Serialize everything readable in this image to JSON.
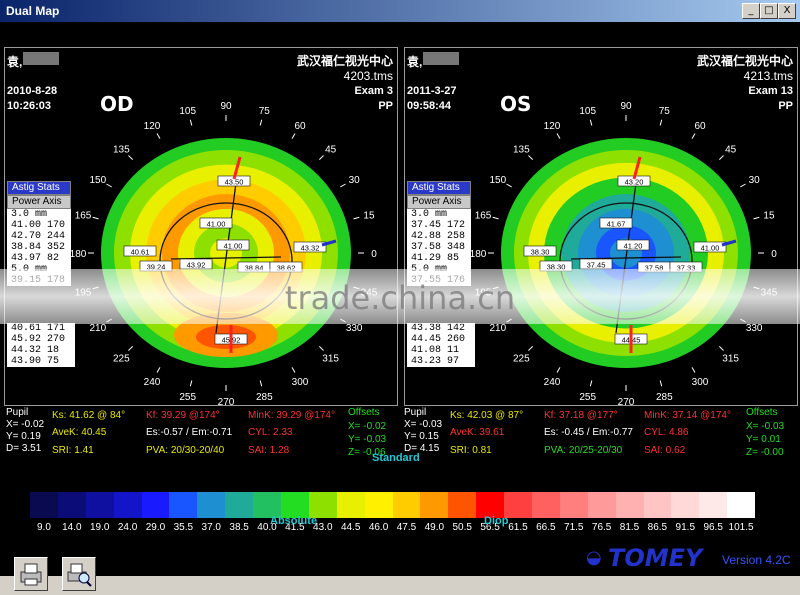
{
  "window": {
    "title": "Dual Map",
    "min": "_",
    "max": "□",
    "close": "X"
  },
  "left": {
    "patient": "袁,",
    "clinic": "武汉福仁视光中心",
    "file": "4203.tms",
    "exam": "Exam 3",
    "date": "2010-8-28",
    "time": "10:26:03",
    "pp": "PP",
    "eye": "OD",
    "astig": {
      "btn1": "Astig Stats",
      "btn2": "Power Axis",
      "rows": [
        "3.0 mm",
        "41.00 170",
        "42.70 244",
        "38.84 352",
        "43.97 82",
        "5.0 mm",
        "39.15 178"
      ],
      "rows2": [
        "40.61 171",
        "45.92 270",
        "44.32 18",
        "43.90 75"
      ]
    },
    "marks": [
      "43.50",
      "41.00",
      "40.61",
      "39.24",
      "43.92",
      "41.00",
      "38.84",
      "38.62",
      "43.32",
      "45.92"
    ],
    "stats": {
      "pupil": "Pupil",
      "x": "X= -0.02",
      "y": "Y= 0.19",
      "d": "D= 3.51",
      "ks": "Ks: 41.62 @ 84°",
      "avek": "AveK: 40.45",
      "sri": "SRI: 1.41",
      "kf": "Kf: 39.29 @174°",
      "es": "Es:-0.57 / Em:-0.71",
      "pva": "PVA: 20/30-20/40",
      "mink": "MinK: 39.29 @174°",
      "cyl": "CYL: 2.33",
      "sai": "SAI: 1.28",
      "offsets": "Offsets",
      "ox": "X= -0.02",
      "oy": "Y= -0.03",
      "oz": "Z= -0.06"
    }
  },
  "right": {
    "patient": "袁,",
    "clinic": "武汉福仁视光中心",
    "file": "4213.tms",
    "exam": "Exam 13",
    "date": "2011-3-27",
    "time": "09:58:44",
    "pp": "PP",
    "eye": "OS",
    "astig": {
      "btn1": "Astig Stats",
      "btn2": "Power Axis",
      "rows": [
        "3.0 mm",
        "37.45 172",
        "42.88 258",
        "37.58 348",
        "41.29 85",
        "5.0 mm",
        "37.55 176"
      ],
      "rows2": [
        "43.38 142",
        "44.45 260",
        "41.08 11",
        "43.23 97"
      ]
    },
    "marks": [
      "43.20",
      "41.67",
      "38.30",
      "38.30",
      "37.45",
      "41.20",
      "37.58",
      "37.33",
      "41.00",
      "44.45"
    ],
    "stats": {
      "pupil": "Pupil",
      "x": "X= -0.03",
      "y": "Y= 0.15",
      "d": "D= 4.15",
      "ks": "Ks: 42.03 @ 87°",
      "avek": "AveK: 39.61",
      "sri": "SRI: 0.81",
      "kf": "Kf: 37.18 @177°",
      "es": "Es: -0.45 / Em:-0.77",
      "pva": "PVA: 20/25-20/30",
      "mink": "MinK: 37.14 @174°",
      "cyl": "CYL: 4.86",
      "sai": "SAI: 0.62",
      "offsets": "Offsets",
      "ox": "X= -0.03",
      "oy": "Y= 0.01",
      "oz": "Z= -0.00"
    }
  },
  "axis_ticks": [
    "0",
    "15",
    "30",
    "45",
    "60",
    "75",
    "90",
    "105",
    "120",
    "135",
    "150",
    "165",
    "180",
    "195",
    "210",
    "225",
    "240",
    "255",
    "270",
    "285",
    "300",
    "315",
    "330",
    "345"
  ],
  "watermark": "trade.china.cn",
  "scale": {
    "name": "Standard",
    "mode_left": "Absolute",
    "mode_right": "Diop",
    "labels": [
      "9.0",
      "14.0",
      "19.0",
      "24.0",
      "29.0",
      "35.5",
      "37.0",
      "38.5",
      "40.0",
      "41.5",
      "43.0",
      "44.5",
      "46.0",
      "47.5",
      "49.0",
      "50.5",
      "56.5",
      "61.5",
      "66.5",
      "71.5",
      "76.5",
      "81.5",
      "86.5",
      "91.5",
      "96.5",
      "101.5"
    ],
    "colors": [
      "#0a0a50",
      "#0c0c78",
      "#1010a0",
      "#1414c8",
      "#1a1aff",
      "#1a56ff",
      "#1e8fd0",
      "#1faa9a",
      "#22c060",
      "#22dd22",
      "#8ee000",
      "#e8f000",
      "#fff000",
      "#ffcc00",
      "#ff9900",
      "#ff5500",
      "#ff0000",
      "#ff4040",
      "#ff6060",
      "#ff7f7f",
      "#ff9a9a",
      "#ffb0b0",
      "#ffc4c4",
      "#ffd8d8",
      "#ffe8e8",
      "#ffffff"
    ]
  },
  "footer": {
    "brand": "TOMEY",
    "version": "Version 4.2C"
  }
}
